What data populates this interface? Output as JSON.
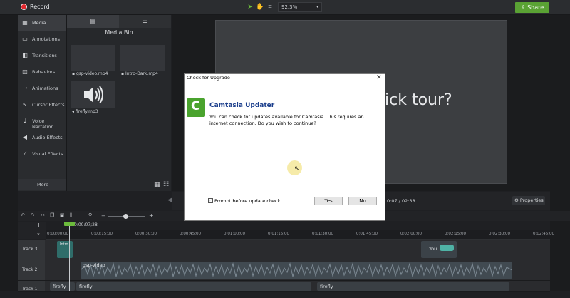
{
  "topbar": {
    "record_label": "Record",
    "zoom_value": "92.3%",
    "share_label": "Share"
  },
  "sidebar": {
    "items": [
      {
        "label": "Media",
        "icon": "film-icon"
      },
      {
        "label": "Annotations",
        "icon": "annotation-icon"
      },
      {
        "label": "Transitions",
        "icon": "transition-icon"
      },
      {
        "label": "Behaviors",
        "icon": "behavior-icon"
      },
      {
        "label": "Animations",
        "icon": "animation-icon"
      },
      {
        "label": "Cursor Effects",
        "icon": "cursor-icon"
      },
      {
        "label": "Voice Narration",
        "icon": "microphone-icon"
      },
      {
        "label": "Audio Effects",
        "icon": "speaker-icon"
      },
      {
        "label": "Visual Effects",
        "icon": "wand-icon"
      }
    ],
    "more_label": "More"
  },
  "media_bin": {
    "title": "Media Bin",
    "items": [
      {
        "label": "gsp-video.mp4",
        "type": "video"
      },
      {
        "label": "Intro-Dark.mp4",
        "type": "video"
      },
      {
        "label": "firefly.mp3",
        "type": "audio"
      }
    ]
  },
  "canvas": {
    "text": "ick tour?"
  },
  "playback": {
    "time_current": "0:07",
    "time_separator": "/",
    "time_total": "02:38",
    "properties_label": "Properties"
  },
  "timeline": {
    "playhead_time": "0:00:07;28",
    "ruler_ticks": [
      "0:00:00;00",
      "0:00:15;00",
      "0:00:30;00",
      "0:00:45;00",
      "0:01:00;00",
      "0:01:15;00",
      "0:01:30;00",
      "0:01:45;00",
      "0:02:00;00",
      "0:02:15;00",
      "0:02:30;00",
      "0:02:45;00"
    ],
    "tracks": [
      {
        "label": "Track 3",
        "clips": [
          {
            "label": "Intro"
          },
          {
            "label": "You"
          }
        ]
      },
      {
        "label": "Track 2",
        "clips": [
          {
            "label": "gsp-video"
          }
        ]
      },
      {
        "label": "Track 1",
        "clips": [
          {
            "label": "firefly"
          },
          {
            "label": "firefly"
          },
          {
            "label": "firefly"
          }
        ]
      }
    ]
  },
  "dialog": {
    "title": "Check for Upgrade",
    "heading": "Camtasia Updater",
    "body": "You can check for updates available for Camtasia. This requires an internet connection. Do you wish to continue?",
    "checkbox_label": "Prompt before update check",
    "checkbox_checked": true,
    "yes_label": "Yes",
    "no_label": "No"
  }
}
